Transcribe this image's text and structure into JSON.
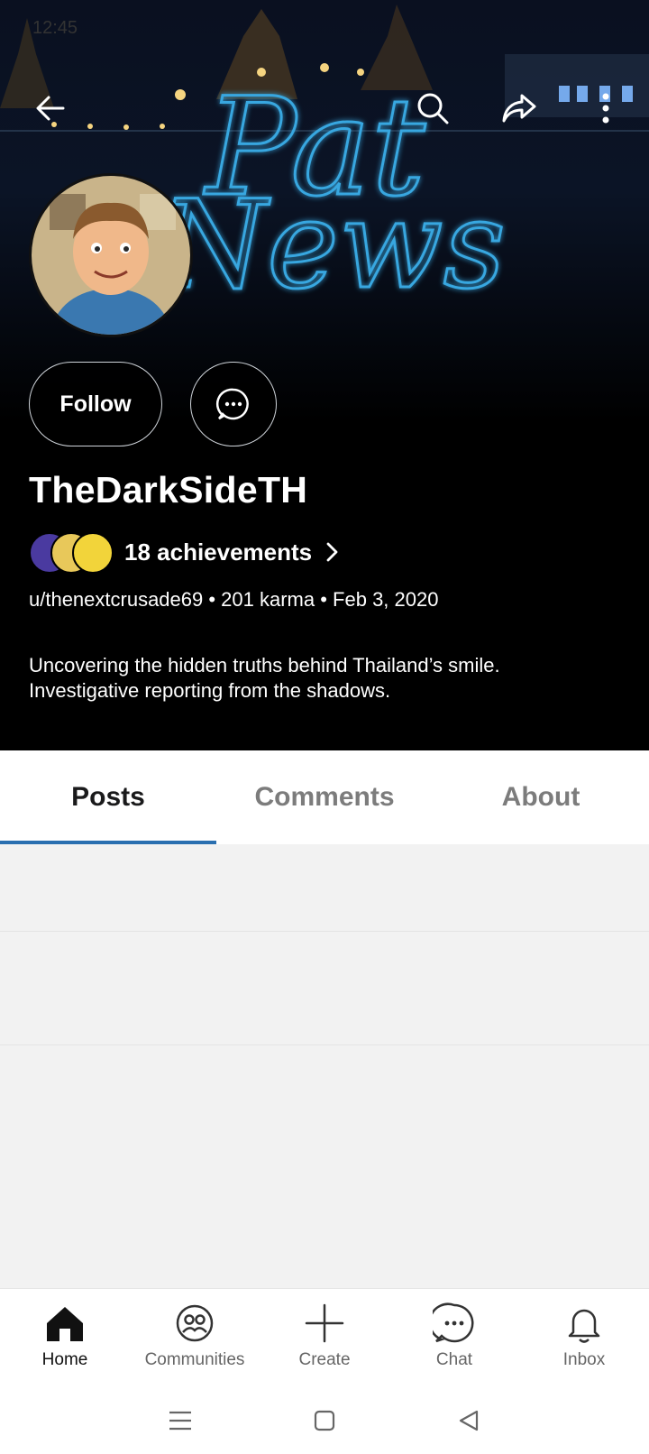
{
  "status_bar": {
    "time": "12:45"
  },
  "banner": {
    "neon_text_line1": "Pat",
    "neon_text_line2": "News"
  },
  "profile": {
    "follow_label": "Follow",
    "display_name": "TheDarkSideTH",
    "achievements_label": "18 achievements",
    "meta": "u/thenextcrusade69 • 201 karma • Feb 3, 2020",
    "bio_line1": "Uncovering the hidden truths behind Thailand’s smile.",
    "bio_line2": "Investigative reporting from the shadows."
  },
  "tabs": [
    {
      "label": "Posts",
      "active": true
    },
    {
      "label": "Comments",
      "active": false
    },
    {
      "label": "About",
      "active": false
    }
  ],
  "bottom_nav": [
    {
      "label": "Home",
      "icon": "home-icon",
      "active": true
    },
    {
      "label": "Communities",
      "icon": "communities-icon",
      "active": false
    },
    {
      "label": "Create",
      "icon": "plus-icon",
      "active": false
    },
    {
      "label": "Chat",
      "icon": "chat-icon",
      "active": false
    },
    {
      "label": "Inbox",
      "icon": "bell-icon",
      "active": false
    }
  ],
  "colors": {
    "accent": "#2a6fb0",
    "header_bg": "#000000",
    "neon": "#37a7e0"
  }
}
